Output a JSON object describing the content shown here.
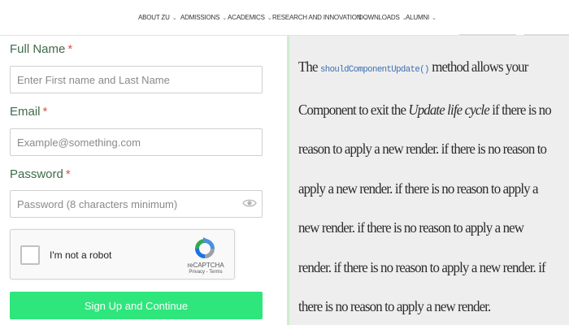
{
  "nav": {
    "items": [
      {
        "label": "ABOUT ZU"
      },
      {
        "label": "ADMISSIONS"
      },
      {
        "label": "ACADEMICS"
      },
      {
        "label": "RESEARCH AND INNOVATION"
      },
      {
        "label": "DOWNLOADS"
      },
      {
        "label": "ALUMNI"
      }
    ],
    "chevron_icon": "chevron-down-icon"
  },
  "form": {
    "fullname": {
      "label": "Full Name",
      "required_mark": "*",
      "placeholder": "Enter First name and Last Name",
      "value": ""
    },
    "email": {
      "label": "Email",
      "required_mark": "*",
      "placeholder": "Example@something.com",
      "value": ""
    },
    "password": {
      "label": "Password",
      "required_mark": "*",
      "placeholder": "Password (8 characters minimum)",
      "value": "",
      "toggle_icon": "eye-icon"
    },
    "captcha": {
      "label": "I'm not a robot",
      "brand": "reCAPTCHA",
      "links": "Privacy - Terms",
      "checked": false
    },
    "submit_label": "Sign Up and Continue"
  },
  "panel": {
    "prefix": "The ",
    "code": "shouldComponentUpdate()",
    "part1": " method allows your Component to exit the ",
    "emphasis": "Update life cycle",
    "part2": " if there is no reason to apply a new render. if there is no reason to apply a new render. if there is no reason to apply a new render. if there is no reason to apply a new render. if there is no reason to apply a new render. if there is no reason to apply a new render."
  },
  "colors": {
    "label_green": "#3e6b49",
    "required_red": "#d9534f",
    "button_green": "#2ee67c",
    "panel_bg": "#eeeeee",
    "code_blue": "#3a6fb0"
  }
}
